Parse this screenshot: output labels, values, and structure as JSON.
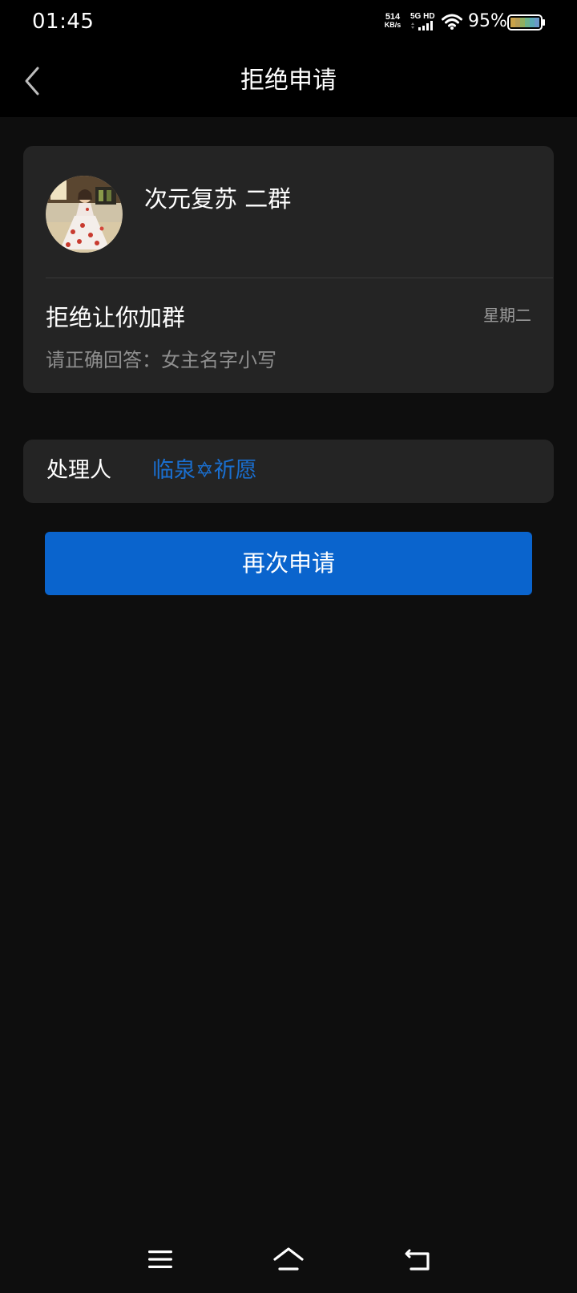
{
  "status_bar": {
    "time": "01:45",
    "net_speed_value": "514",
    "net_speed_unit": "KB/s",
    "network_label": "5G HD",
    "battery_percent": "95%"
  },
  "header": {
    "back_icon": "chevron-left-icon",
    "title": "拒绝申请"
  },
  "group_card": {
    "group_name": "次元复苏 二群",
    "status_title": "拒绝让你加群",
    "date": "星期二",
    "reason": "请正确回答：女主名字小写"
  },
  "handler": {
    "label": "处理人",
    "name": "临泉✡祈愿"
  },
  "actions": {
    "reapply_label": "再次申请"
  },
  "system_nav": {
    "menu_icon": "menu-icon",
    "home_icon": "home-icon",
    "back_icon": "return-icon"
  },
  "colors": {
    "background": "#0e0e0e",
    "card": "#242424",
    "accent": "#0a64cd",
    "link": "#1a6fd0"
  }
}
